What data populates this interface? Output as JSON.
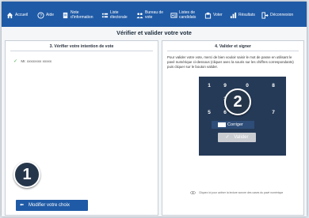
{
  "nav": {
    "items": [
      {
        "label": "Accueil",
        "icon": "home-icon"
      },
      {
        "label": "Aide",
        "icon": "help-icon"
      },
      {
        "label": "Note d'information",
        "icon": "document-icon"
      },
      {
        "label": "Liste électorale",
        "icon": "list-icon"
      },
      {
        "label": "Bureau de vote",
        "icon": "people-icon"
      },
      {
        "label": "Listes de candidats",
        "icon": "candidates-icon"
      },
      {
        "label": "Voter",
        "icon": "ballot-icon"
      },
      {
        "label": "Résultats",
        "icon": "chart-icon"
      },
      {
        "label": "Déconnexion",
        "icon": "logout-icon"
      }
    ]
  },
  "page_title": "Vérifier et valider votre vote",
  "left_panel": {
    "title": "3. Vérifier votre intention de vote",
    "choice": "Mr. xxxxxxxx xxxxx",
    "modify_button": "Modifier votre choix",
    "badge": "1"
  },
  "right_panel": {
    "title": "4. Valider et signer",
    "instructions": "Pour valider votre vote, merci de bien vouloir saisir le mot de passe en utilisant le pavé numérique ci-dessous (cliquer avec la souris sur les chiffres correspondants) puis cliquer sur le bouton valider.",
    "keypad_keys": [
      "1",
      "9",
      "0",
      "8",
      "3",
      "",
      "5",
      "6",
      "7"
    ],
    "correct_button": "Corriger",
    "validate_button": "Valider",
    "footer_note": "Cliquez ici pour activer la lecture sonore des cases du pavé numérique",
    "badge": "2"
  },
  "colors": {
    "primary": "#1f5aa6",
    "keypad": "#253a57",
    "check": "#4caf50"
  }
}
